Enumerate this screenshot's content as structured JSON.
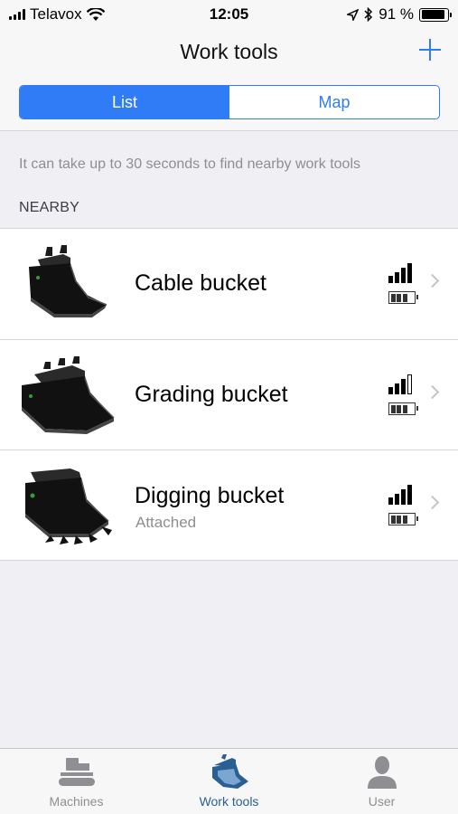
{
  "status_bar": {
    "carrier": "Telavox",
    "time": "12:05",
    "battery": "91 %",
    "battery_level": 0.91
  },
  "nav": {
    "title": "Work tools",
    "add_icon": "plus-icon"
  },
  "segmented": {
    "list_label": "List",
    "map_label": "Map",
    "selected": "List"
  },
  "hint": "It can take up to 30 seconds to find nearby work tools",
  "section_header": "NEARBY",
  "tools": [
    {
      "name": "Cable bucket",
      "subtitle": "",
      "signal_bars": 4,
      "battery_bars": 3
    },
    {
      "name": "Grading bucket",
      "subtitle": "",
      "signal_bars": 3,
      "battery_bars": 3
    },
    {
      "name": "Digging bucket",
      "subtitle": "Attached",
      "signal_bars": 4,
      "battery_bars": 3
    }
  ],
  "tab_bar": {
    "items": [
      {
        "label": "Machines",
        "icon": "excavator-icon"
      },
      {
        "label": "Work tools",
        "icon": "bucket-icon"
      },
      {
        "label": "User",
        "icon": "user-icon"
      }
    ],
    "active": "Work tools"
  },
  "colors": {
    "accent": "#2f7cf6",
    "tab_active": "#2a5f94",
    "background": "#efeff4"
  }
}
